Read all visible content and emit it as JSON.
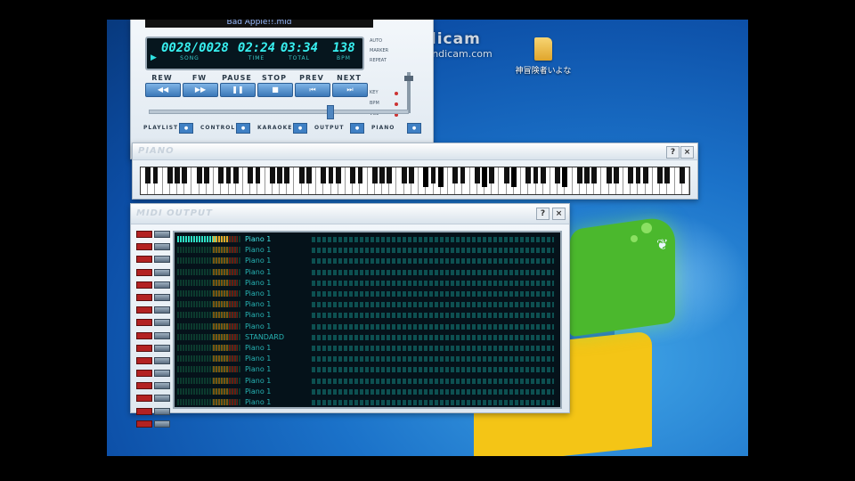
{
  "player": {
    "filename": "Bad Apple!!.mid",
    "song": "0028/0028",
    "time": "02:24",
    "total": "03:34",
    "bpm": "138",
    "song_label": "SONG",
    "time_label": "TIME",
    "total_label": "TOTAL",
    "bpm_label": "BPM",
    "transport": [
      {
        "label": "REW",
        "glyph": "◀◀"
      },
      {
        "label": "FW",
        "glyph": "▶▶"
      },
      {
        "label": "PAUSE",
        "glyph": "❚❚"
      },
      {
        "label": "STOP",
        "glyph": "■"
      },
      {
        "label": "PREV",
        "glyph": "⏮"
      },
      {
        "label": "NEXT",
        "glyph": "⏭"
      }
    ],
    "panels": [
      "PLAYLIST",
      "CONTROL",
      "KARAOKE",
      "OUTPUT",
      "PIANO"
    ],
    "seek_fraction": 0.69,
    "right_panel": [
      "AUTO",
      "MARKER",
      "REPEAT",
      "KEY",
      "BPM",
      "VOL"
    ]
  },
  "piano_window": {
    "title": "PIANO",
    "help": "?",
    "close": "×"
  },
  "midi_window": {
    "title": "MIDI OUTPUT",
    "help": "?",
    "close": "×",
    "channels": [
      {
        "inst": "Piano 1",
        "level": 0.62
      },
      {
        "inst": "Piano 1",
        "level": 0
      },
      {
        "inst": "Piano 1",
        "level": 0
      },
      {
        "inst": "Piano 1",
        "level": 0
      },
      {
        "inst": "Piano 1",
        "level": 0
      },
      {
        "inst": "Piano 1",
        "level": 0
      },
      {
        "inst": "Piano 1",
        "level": 0
      },
      {
        "inst": "Piano 1",
        "level": 0
      },
      {
        "inst": "Piano 1",
        "level": 0
      },
      {
        "inst": "STANDARD",
        "level": 0
      },
      {
        "inst": "Piano 1",
        "level": 0
      },
      {
        "inst": "Piano 1",
        "level": 0
      },
      {
        "inst": "Piano 1",
        "level": 0
      },
      {
        "inst": "Piano 1",
        "level": 0
      },
      {
        "inst": "Piano 1",
        "level": 0
      },
      {
        "inst": "Piano 1",
        "level": 0
      }
    ]
  },
  "desktop": {
    "folder_label": "神冒険者いよな",
    "watermark_line1": "Bandicam",
    "watermark_line2": "www.bandicam.com"
  },
  "colors": {
    "lcd_text": "#38f0f0",
    "button_blue": "#3f80c4",
    "mute_red": "#b32222"
  }
}
